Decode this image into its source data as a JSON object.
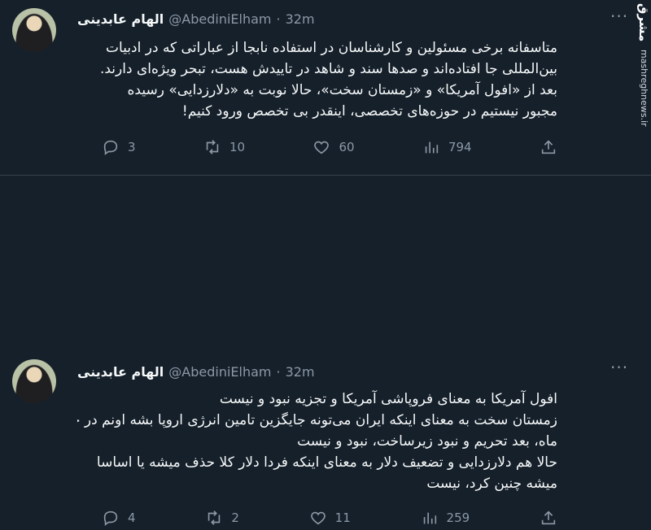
{
  "tweets": [
    {
      "name": "الهام عابدینی",
      "handle": "@AbediniElham",
      "dot": "·",
      "time": "32m",
      "lines": [
        "متاسفانه برخی مسئولین و کارشناسان در استفاده نابجا از عباراتی که در ادبیات",
        "بین‌المللی جا افتاده‌اند و صدها سند و شاهد در تاییدش هست، تبحر ویژه‌ای دارند.",
        "بعد از «افول آمریکا» و «زمستان سخت»، حالا نوبت به «دلارزدایی» رسیده",
        "مجبور نیستیم در حوزه‌های تخصصی، اینقدر بی تخصص ورود کنیم!"
      ],
      "replies": "3",
      "retweets": "10",
      "likes": "60",
      "views": "794"
    },
    {
      "name": "الهام عابدینی",
      "handle": "@AbediniElham",
      "dot": "·",
      "time": "32m",
      "lines": [
        "افول آمریکا به معنای فروپاشی آمریکا و تجزیه نبود و نیست",
        "زمستان سخت به معنای اینکه ایران می‌تونه جایگزین تامین انرژی اروپا بشه اونم در چند",
        "ماه، بعد تحریم و نبود زیرساخت، نبود و نیست",
        "حالا هم دلارزدایی و تضعیف دلار به معنای اینکه فردا دلار کلا حذف میشه یا اساسا",
        "میشه چنین کرد، نیست"
      ],
      "replies": "4",
      "retweets": "2",
      "likes": "11",
      "views": "259"
    }
  ],
  "more_label": "···",
  "watermark": {
    "logo": "مشرق",
    "site": "mashreghnews.ir"
  },
  "icons": [
    "reply-icon",
    "retweet-icon",
    "like-icon",
    "views-icon",
    "share-icon",
    "more-icon"
  ],
  "colors": {
    "background": "#15202b",
    "text": "#f7f9f9",
    "muted": "#8b98a5",
    "divider": "#38444d"
  }
}
